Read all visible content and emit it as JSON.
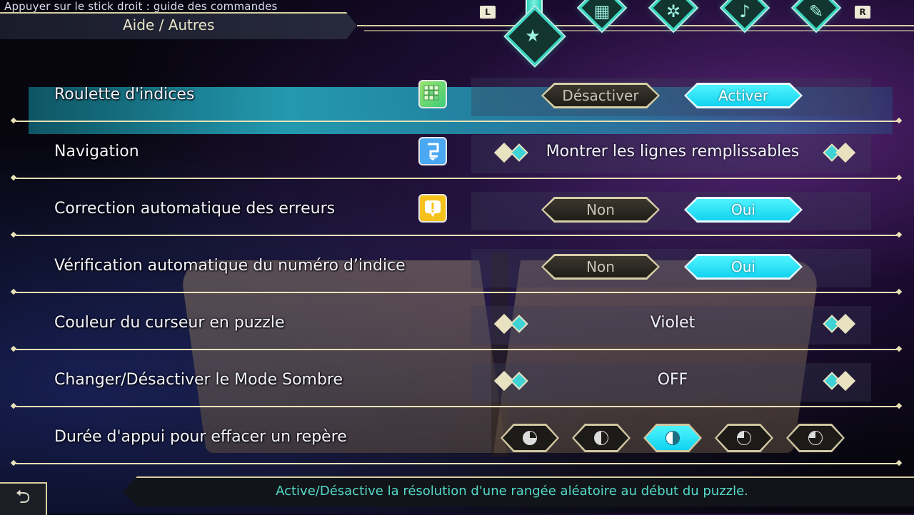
{
  "header": {
    "hint": "Appuyer sur le stick droit : guide des commandes",
    "title": "Aide / Autres"
  },
  "tabs": {
    "left_shoulder": "L",
    "right_shoulder": "R",
    "items": [
      {
        "icon": "star-icon",
        "glyph": "★",
        "active": true
      },
      {
        "icon": "grid-icon",
        "glyph": "▦",
        "active": false
      },
      {
        "icon": "character-icon",
        "glyph": "✲",
        "active": false
      },
      {
        "icon": "music-note-icon",
        "glyph": "♪",
        "active": false
      },
      {
        "icon": "wrench-icon",
        "glyph": "✎",
        "active": false
      }
    ]
  },
  "settings": {
    "hint_roulette": {
      "label": "Roulette d'indices",
      "icon": "grid-icon",
      "options": [
        "Désactiver",
        "Activer"
      ],
      "selected": "Activer"
    },
    "navigation": {
      "label": "Navigation",
      "icon": "navigation-icon",
      "value": "Montrer les lignes remplissables"
    },
    "auto_correction": {
      "label": "Correction automatique des erreurs",
      "icon": "warning-icon",
      "options": [
        "Non",
        "Oui"
      ],
      "selected": "Oui"
    },
    "auto_check": {
      "label": "Vérification automatique du numéro d’indice",
      "options": [
        "Non",
        "Oui"
      ],
      "selected": "Oui"
    },
    "cursor_color": {
      "label": "Couleur du curseur en puzzle",
      "value": "Violet"
    },
    "dark_mode": {
      "label": "Changer/Désactiver le Mode Sombre",
      "value": "OFF"
    },
    "press_duration": {
      "label": "Durée d'appui pour effacer un repère",
      "levels": 5,
      "selected_index": 2
    }
  },
  "footer": {
    "description": "Active/Désactive la résolution d'une rangée aléatoire au début du puzzle.",
    "back_icon": "back-arrow-icon"
  },
  "colors": {
    "accent_cyan": "#1fdcf2",
    "gold_border": "#d8cfa1",
    "footer_text": "#53d9c9"
  }
}
